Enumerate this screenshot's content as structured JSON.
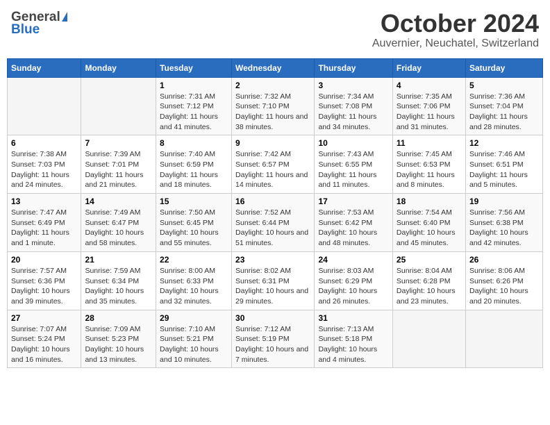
{
  "header": {
    "logo_general": "General",
    "logo_blue": "Blue",
    "month": "October 2024",
    "location": "Auvernier, Neuchatel, Switzerland"
  },
  "days_of_week": [
    "Sunday",
    "Monday",
    "Tuesday",
    "Wednesday",
    "Thursday",
    "Friday",
    "Saturday"
  ],
  "weeks": [
    [
      {
        "day": null,
        "sunrise": null,
        "sunset": null,
        "daylight": null
      },
      {
        "day": null,
        "sunrise": null,
        "sunset": null,
        "daylight": null
      },
      {
        "day": "1",
        "sunrise": "Sunrise: 7:31 AM",
        "sunset": "Sunset: 7:12 PM",
        "daylight": "Daylight: 11 hours and 41 minutes."
      },
      {
        "day": "2",
        "sunrise": "Sunrise: 7:32 AM",
        "sunset": "Sunset: 7:10 PM",
        "daylight": "Daylight: 11 hours and 38 minutes."
      },
      {
        "day": "3",
        "sunrise": "Sunrise: 7:34 AM",
        "sunset": "Sunset: 7:08 PM",
        "daylight": "Daylight: 11 hours and 34 minutes."
      },
      {
        "day": "4",
        "sunrise": "Sunrise: 7:35 AM",
        "sunset": "Sunset: 7:06 PM",
        "daylight": "Daylight: 11 hours and 31 minutes."
      },
      {
        "day": "5",
        "sunrise": "Sunrise: 7:36 AM",
        "sunset": "Sunset: 7:04 PM",
        "daylight": "Daylight: 11 hours and 28 minutes."
      }
    ],
    [
      {
        "day": "6",
        "sunrise": "Sunrise: 7:38 AM",
        "sunset": "Sunset: 7:03 PM",
        "daylight": "Daylight: 11 hours and 24 minutes."
      },
      {
        "day": "7",
        "sunrise": "Sunrise: 7:39 AM",
        "sunset": "Sunset: 7:01 PM",
        "daylight": "Daylight: 11 hours and 21 minutes."
      },
      {
        "day": "8",
        "sunrise": "Sunrise: 7:40 AM",
        "sunset": "Sunset: 6:59 PM",
        "daylight": "Daylight: 11 hours and 18 minutes."
      },
      {
        "day": "9",
        "sunrise": "Sunrise: 7:42 AM",
        "sunset": "Sunset: 6:57 PM",
        "daylight": "Daylight: 11 hours and 14 minutes."
      },
      {
        "day": "10",
        "sunrise": "Sunrise: 7:43 AM",
        "sunset": "Sunset: 6:55 PM",
        "daylight": "Daylight: 11 hours and 11 minutes."
      },
      {
        "day": "11",
        "sunrise": "Sunrise: 7:45 AM",
        "sunset": "Sunset: 6:53 PM",
        "daylight": "Daylight: 11 hours and 8 minutes."
      },
      {
        "day": "12",
        "sunrise": "Sunrise: 7:46 AM",
        "sunset": "Sunset: 6:51 PM",
        "daylight": "Daylight: 11 hours and 5 minutes."
      }
    ],
    [
      {
        "day": "13",
        "sunrise": "Sunrise: 7:47 AM",
        "sunset": "Sunset: 6:49 PM",
        "daylight": "Daylight: 11 hours and 1 minute."
      },
      {
        "day": "14",
        "sunrise": "Sunrise: 7:49 AM",
        "sunset": "Sunset: 6:47 PM",
        "daylight": "Daylight: 10 hours and 58 minutes."
      },
      {
        "day": "15",
        "sunrise": "Sunrise: 7:50 AM",
        "sunset": "Sunset: 6:45 PM",
        "daylight": "Daylight: 10 hours and 55 minutes."
      },
      {
        "day": "16",
        "sunrise": "Sunrise: 7:52 AM",
        "sunset": "Sunset: 6:44 PM",
        "daylight": "Daylight: 10 hours and 51 minutes."
      },
      {
        "day": "17",
        "sunrise": "Sunrise: 7:53 AM",
        "sunset": "Sunset: 6:42 PM",
        "daylight": "Daylight: 10 hours and 48 minutes."
      },
      {
        "day": "18",
        "sunrise": "Sunrise: 7:54 AM",
        "sunset": "Sunset: 6:40 PM",
        "daylight": "Daylight: 10 hours and 45 minutes."
      },
      {
        "day": "19",
        "sunrise": "Sunrise: 7:56 AM",
        "sunset": "Sunset: 6:38 PM",
        "daylight": "Daylight: 10 hours and 42 minutes."
      }
    ],
    [
      {
        "day": "20",
        "sunrise": "Sunrise: 7:57 AM",
        "sunset": "Sunset: 6:36 PM",
        "daylight": "Daylight: 10 hours and 39 minutes."
      },
      {
        "day": "21",
        "sunrise": "Sunrise: 7:59 AM",
        "sunset": "Sunset: 6:34 PM",
        "daylight": "Daylight: 10 hours and 35 minutes."
      },
      {
        "day": "22",
        "sunrise": "Sunrise: 8:00 AM",
        "sunset": "Sunset: 6:33 PM",
        "daylight": "Daylight: 10 hours and 32 minutes."
      },
      {
        "day": "23",
        "sunrise": "Sunrise: 8:02 AM",
        "sunset": "Sunset: 6:31 PM",
        "daylight": "Daylight: 10 hours and 29 minutes."
      },
      {
        "day": "24",
        "sunrise": "Sunrise: 8:03 AM",
        "sunset": "Sunset: 6:29 PM",
        "daylight": "Daylight: 10 hours and 26 minutes."
      },
      {
        "day": "25",
        "sunrise": "Sunrise: 8:04 AM",
        "sunset": "Sunset: 6:28 PM",
        "daylight": "Daylight: 10 hours and 23 minutes."
      },
      {
        "day": "26",
        "sunrise": "Sunrise: 8:06 AM",
        "sunset": "Sunset: 6:26 PM",
        "daylight": "Daylight: 10 hours and 20 minutes."
      }
    ],
    [
      {
        "day": "27",
        "sunrise": "Sunrise: 7:07 AM",
        "sunset": "Sunset: 5:24 PM",
        "daylight": "Daylight: 10 hours and 16 minutes."
      },
      {
        "day": "28",
        "sunrise": "Sunrise: 7:09 AM",
        "sunset": "Sunset: 5:23 PM",
        "daylight": "Daylight: 10 hours and 13 minutes."
      },
      {
        "day": "29",
        "sunrise": "Sunrise: 7:10 AM",
        "sunset": "Sunset: 5:21 PM",
        "daylight": "Daylight: 10 hours and 10 minutes."
      },
      {
        "day": "30",
        "sunrise": "Sunrise: 7:12 AM",
        "sunset": "Sunset: 5:19 PM",
        "daylight": "Daylight: 10 hours and 7 minutes."
      },
      {
        "day": "31",
        "sunrise": "Sunrise: 7:13 AM",
        "sunset": "Sunset: 5:18 PM",
        "daylight": "Daylight: 10 hours and 4 minutes."
      },
      {
        "day": null,
        "sunrise": null,
        "sunset": null,
        "daylight": null
      },
      {
        "day": null,
        "sunrise": null,
        "sunset": null,
        "daylight": null
      }
    ]
  ]
}
